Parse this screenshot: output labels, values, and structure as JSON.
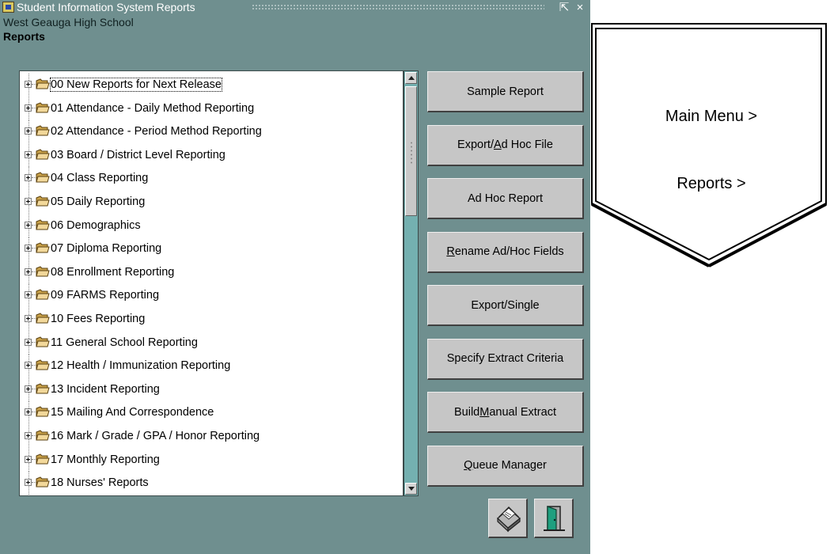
{
  "window": {
    "title": "Student Information System Reports",
    "maximize_glyph": "⇱",
    "close_glyph": "×"
  },
  "header": {
    "school_name": "West Geauga High School",
    "section_title": "Reports"
  },
  "tree": {
    "selected_index": 0,
    "items": [
      "00 New Reports for Next Release",
      "01 Attendance - Daily Method Reporting",
      "02 Attendance - Period Method Reporting",
      "03 Board / District Level Reporting",
      "04 Class Reporting",
      "05 Daily Reporting",
      "06 Demographics",
      "07 Diploma Reporting",
      "08 Enrollment Reporting",
      "09 FARMS Reporting",
      "10 Fees Reporting",
      "11 General School Reporting",
      "12 Health / Immunization Reporting",
      "13 Incident Reporting",
      "15 Mailing And Correspondence",
      "16 Mark / Grade / GPA / Honor Reporting",
      "17 Monthly Reporting",
      "18 Nurses' Reports"
    ]
  },
  "buttons": [
    {
      "name": "sample-report-button",
      "before": "Sample Report",
      "mnemonic": "",
      "after": ""
    },
    {
      "name": "export-ad-hoc-file-button",
      "before": "Export/",
      "mnemonic": "A",
      "after": "d Hoc File"
    },
    {
      "name": "ad-hoc-report-button",
      "before": "Ad Hoc Report",
      "mnemonic": "",
      "after": ""
    },
    {
      "name": "rename-ad-hoc-fields-button",
      "before": "",
      "mnemonic": "R",
      "after": "ename Ad/Hoc Fields"
    },
    {
      "name": "export-single-button",
      "before": "Export/Single",
      "mnemonic": "",
      "after": ""
    },
    {
      "name": "specify-extract-criteria-button",
      "before": "Specify Extract Criteria",
      "mnemonic": "",
      "after": ""
    },
    {
      "name": "build-manual-extract-button",
      "before": "Build ",
      "mnemonic": "M",
      "after": "anual Extract"
    },
    {
      "name": "queue-manager-button",
      "before": "",
      "mnemonic": "Q",
      "after": "ueue Manager"
    }
  ],
  "toolbar_icons": {
    "print": "printer-icon",
    "exit": "exit-door-icon"
  },
  "breadcrumb": {
    "line1": "Main Menu >",
    "line2": "Reports >"
  },
  "colors": {
    "window_bg": "#6f8f8f",
    "scroll_track": "#74b0b0",
    "button_face": "#c6c6c6"
  }
}
